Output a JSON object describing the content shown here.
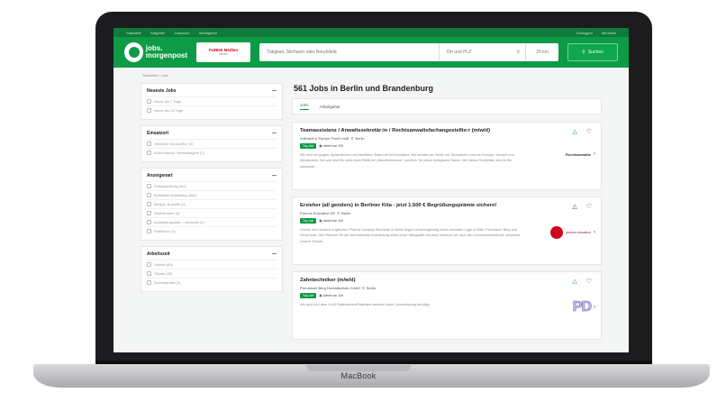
{
  "device": {
    "brand": "MacBook"
  },
  "topbar": {
    "left_items": [
      "Startseite",
      "Ratgeber",
      "Jobsuche",
      "Arbeitgeber"
    ],
    "right_items": [
      "Einloggen",
      "Merkliste"
    ]
  },
  "header": {
    "logo_text_1": "jobs.",
    "logo_text_2": "morgenpost",
    "partner_logo": "FUNKE Medien",
    "partner_logo_sub": "Berlin",
    "search_placeholder": "Tätigkeit, Stichwort oder Berufsfeld",
    "location_placeholder": "Ort und PLZ",
    "radius": "20 km",
    "search_button": "Suchen"
  },
  "breadcrumb": "Startseite › Jobs",
  "filters": [
    {
      "title": "Neueste Jobs",
      "options": [
        "Neuer als 7 Tage",
        "Neuer als 14 Tage"
      ]
    },
    {
      "title": "Einsatzort",
      "options": [
        "Teilweise Homeoffice (0)",
        "Außendienst / Reisetätigkeit (7)"
      ]
    },
    {
      "title": "Anzeigenart",
      "options": [
        "Festanstellung (511)",
        "Befristete Anstellung (366)",
        "Minijob, Aushilfe (9)",
        "Werkstudent (6)",
        "Ausbildungsplatz, Lehrstelle (2)",
        "Praktikum (3)"
      ]
    },
    {
      "title": "Arbeitszeit",
      "options": [
        "Vollzeit (60)",
        "Teilzeit (45)",
        "Schichtarbeit (3)"
      ]
    }
  ],
  "results": {
    "heading": "561 Jobs in Berlin und Brandenburg",
    "tabs": [
      "Jobs",
      "Arbeitgeber"
    ],
    "jobs": [
      {
        "title": "Teamassistenz / Anwaltssekretär:in / Rechtsanwaltsfachangestellte:r (m/w/d)",
        "company": "Vollhardt & Partner PartG mbB",
        "location": "Berlin",
        "tag_new": "Top Job",
        "tag_extra": "Arbeit von 10h",
        "description": "Wir sind ein junges, dynamisches und familiäres Team mit fünf Anwälten. Wir beraten am Berlin zur Sozialrecht rund um Energie, Umwelt und Infrastruktur. Bei uns sind Sie nicht einer Stelle im „Maschinenraum“, sondern Teil eines kollegialen Teams. Wir bieten Flexibilität, das für Sie passende...",
        "employer": "Rechtsanwälte"
      },
      {
        "title": "Erzieher (all genders) in Berliner Kita - jetzt 1.500 € Begrüßungsprämie sichern!",
        "company": "Phorms Education SE",
        "location": "Berlin",
        "tag_new": "Top Job",
        "tag_extra": "Arbeit von 10h",
        "description": "Unsere drei deutsch-englischen Phorms Campus Standorte in Berlin liegen verkehrsgünstig und in zentraler Lage in Mitte, Prenzlauer Berg und Zehlendorf. Den Rahmen für die internationale Ausrichtung bildet unser bilinguales Konzept, welches wir nach der Immersionsmethode umsetzen. Unsere Schule...",
        "employer": "phorms education"
      },
      {
        "title": "Zahntechniker (m/w/d)",
        "company": "Prenzlauer Berg Dentaltechnik GmbH",
        "location": "Berlin",
        "tag_new": "Top Job",
        "tag_extra": "Arbeit von 10h",
        "description": "Wir sind ein Labor in 60 Patientinnen/Patienten welches ihnen Unterstützung benötigt.",
        "employer": "PD"
      }
    ]
  },
  "colors": {
    "brand_green": "#0d9b46",
    "dark_green": "#0f7a3a",
    "bezel": "#1c1c1e"
  }
}
